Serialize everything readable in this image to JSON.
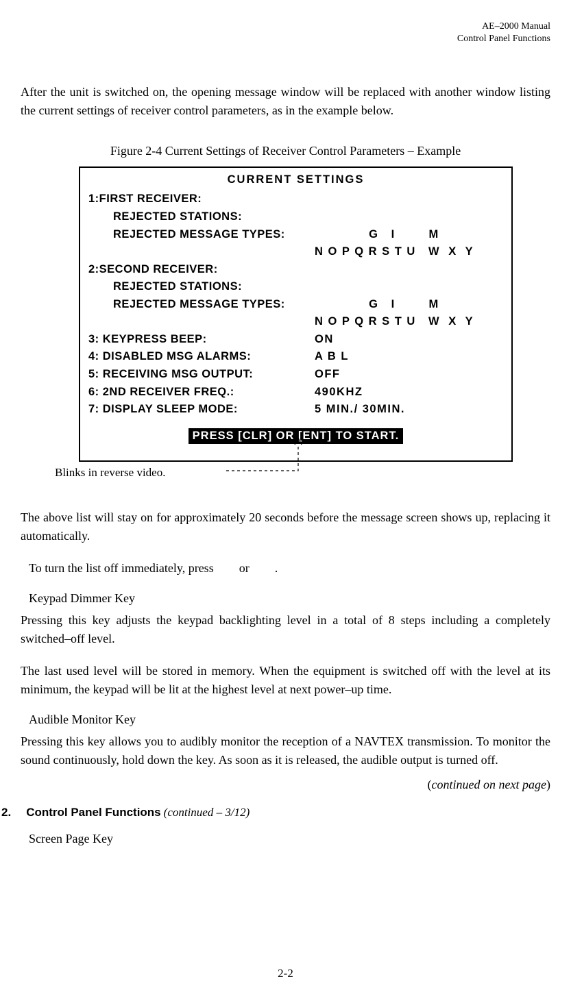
{
  "header": {
    "line1": "AE–2000 Manual",
    "line2": "Control Panel Functions"
  },
  "para1": "After the unit is switched on, the opening message window will be replaced with another window listing the current settings of receiver control parameters, as in the example below.",
  "figure_caption": "Figure 2-4 Current Settings of Receiver Control Parameters – Example",
  "screen": {
    "title": "CURRENT SETTINGS",
    "r1": "1:FIRST RECEIVER:",
    "r1a": "REJECTED STATIONS:",
    "r1b": "REJECTED MESSAGE TYPES:",
    "r1b_right1": "             G   I        M",
    "r1b_right2": "N O P Q R S T U   W  X  Y",
    "r2": "2:SECOND RECEIVER:",
    "r2a": "REJECTED STATIONS:",
    "r2b": "REJECTED MESSAGE TYPES:",
    "r2b_right1": "             G   I        M",
    "r2b_right2": "N O P Q R S T U   W  X  Y",
    "r3": "3: KEYPRESS BEEP:",
    "r3_right": "ON",
    "r4": "4: DISABLED MSG ALARMS:",
    "r4_right": "A B L",
    "r5": "5: RECEIVING MSG OUTPUT:",
    "r5_right": "OFF",
    "r6": "6: 2ND RECEIVER FREQ.:",
    "r6_right": "490KHZ",
    "r7": "7: DISPLAY SLEEP MODE:",
    "r7_right": "5 MIN./ 30MIN.",
    "banner": "PRESS [CLR] OR [ENT] TO START."
  },
  "annotation": "Blinks in reverse video.",
  "para2": "The above list will stay on for approximately 20 seconds before the message screen shows up, replacing it automatically.",
  "para3_pre": "To turn the list off immediately, press",
  "para3_mid": "or",
  "para3_post": ".",
  "heading_dimmer": "Keypad Dimmer Key",
  "para_dimmer1": "Pressing this key adjusts the keypad backlighting level in a total of 8 steps including a completely switched–off level.",
  "para_dimmer2": "The last used level will be stored in memory. When the equipment is switched off with the level at its minimum, the keypad will be lit at the highest level at next power–up time.",
  "heading_audible": "Audible Monitor Key",
  "para_audible": "Pressing this key allows you to audibly monitor the reception of a NAVTEX transmission. To monitor the sound continuously, hold down the key. As soon as it is released, the audible output is turned off.",
  "continued_note": "continued on next page",
  "section2": {
    "num": "2.",
    "title": "Control Panel Functions",
    "suffix": "continued – 3/12"
  },
  "heading_screenpage": "Screen Page Key",
  "page_number": "2-2"
}
